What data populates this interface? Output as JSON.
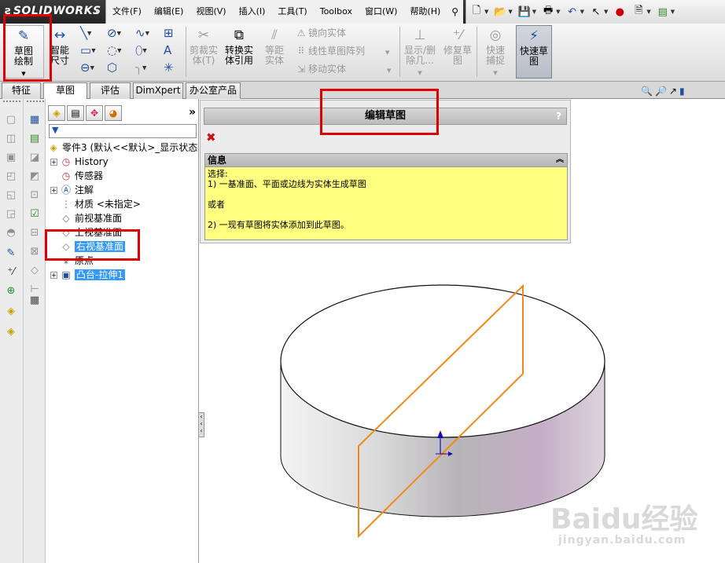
{
  "app": {
    "logo": "SOLIDWORKS"
  },
  "menu": [
    "文件(F)",
    "编辑(E)",
    "视图(V)",
    "插入(I)",
    "工具(T)",
    "Toolbox",
    "窗口(W)",
    "帮助(H)"
  ],
  "commands": {
    "sketch": "草图绘制",
    "smart_dim": "智能尺寸",
    "trim": "剪裁实体(T)",
    "convert": "转换实体引用",
    "offset": "等距实体",
    "mirror": "镜向实体",
    "linear_pattern": "线性草图阵列",
    "move": "移动实体",
    "show_delete": "显示/删除几...",
    "repair": "修复草图",
    "quick_snap": "快速捕捉",
    "rapid_sketch": "快速草图"
  },
  "tabs": [
    "特征",
    "草图",
    "评估",
    "DimXpert",
    "办公室产品"
  ],
  "tree": {
    "root": "零件3 (默认<<默认>_显示状态",
    "items": [
      {
        "label": "History",
        "expandable": true
      },
      {
        "label": "传感器",
        "expandable": false
      },
      {
        "label": "注解",
        "expandable": true
      },
      {
        "label": "材质 <未指定>",
        "expandable": false
      },
      {
        "label": "前视基准面",
        "expandable": false
      },
      {
        "label": "上视基准面",
        "expandable": false
      },
      {
        "label": "右视基准面",
        "expandable": false
      },
      {
        "label": "原点",
        "expandable": false
      },
      {
        "label": "凸台-拉伸1",
        "expandable": true
      }
    ]
  },
  "property_manager": {
    "title": "编辑草图",
    "help": "?",
    "info_header": "信息",
    "info_lines": [
      "选择:",
      "1) 一基准面、平面或边线为实体生成草图",
      "",
      "或者",
      "",
      "2) 一现有草图将实体添加到此草图。"
    ]
  },
  "watermark": {
    "line1": "Baidu经验",
    "line2": "jingyan.baidu.com"
  },
  "colors": {
    "plane_edge": "#f08a1a",
    "highlight": "#e00000",
    "info_bg": "#ffff80",
    "selection": "#3399ff"
  }
}
